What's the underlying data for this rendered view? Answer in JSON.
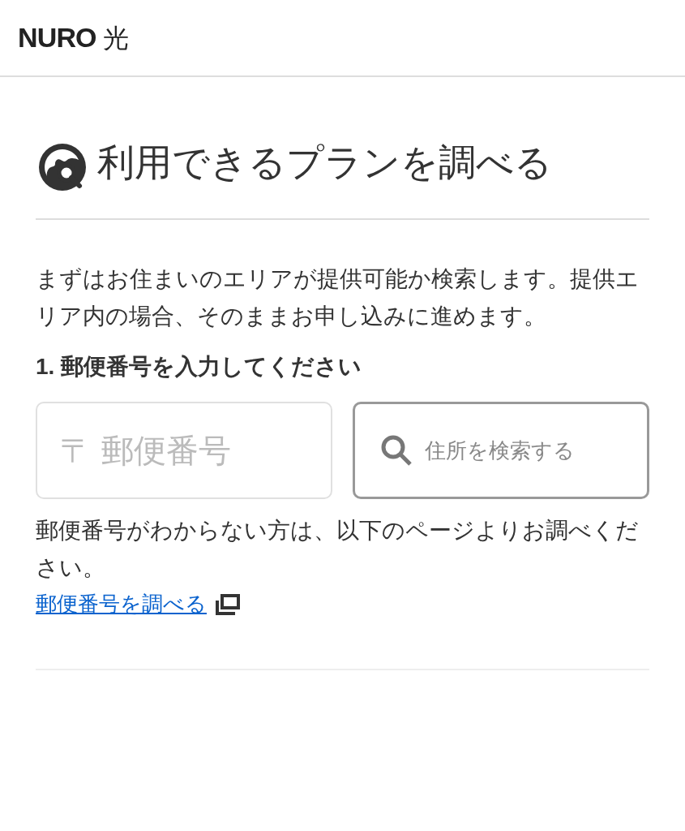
{
  "header": {
    "logo": "NURO",
    "logo_suffix": "光"
  },
  "heading": "利用できるプランを調べる",
  "intro": "まずはお住まいのエリアが提供可能か検索します。提供エリア内の場合、そのままお申し込みに進めます。",
  "step_label": "1. 郵便番号を入力してください",
  "postal_field": {
    "placeholder": "〒 郵便番号"
  },
  "address_search_button": "住所を検索する",
  "help_text": "郵便番号がわからない方は、以下のページよりお調べください。",
  "lookup_link": "郵便番号を調べる"
}
